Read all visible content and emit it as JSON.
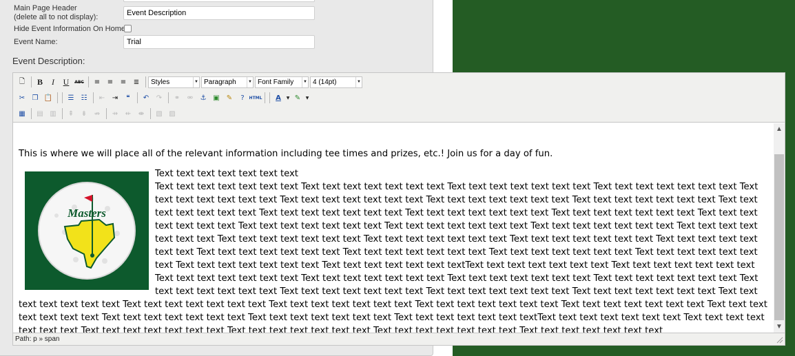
{
  "form": {
    "main_header_label": "Main Page Header",
    "main_header_sublabel": "(delete all to not display):",
    "main_header_value": "Event Description",
    "hide_event_label": "Hide Event Information On Home:",
    "event_name_label": "Event Name:",
    "event_name_value": "Trial",
    "event_description_label": "Event Description:"
  },
  "editor": {
    "toolbar": {
      "styles": "Styles",
      "format": "Paragraph",
      "font_family": "Font Family",
      "font_size": "4 (14pt)",
      "html_label": "HTML"
    },
    "content": {
      "intro": "This is where we will place all of the relevant information including tee times and prizes, etc.! Join us for a day of fun.",
      "first_line": "Text text text text text text text",
      "body": "Text text text text text text text Text text text text text text text Text text text text text text text Text text text text text text text Text text text text text text text Text text text text text text text Text text text text text text text Text text text text text text text Text text text text text text text Text text text text text text text Text text text text text text text Text text text text text text text Text text text text text text text Text text text text text text text Text text text text text text text Text text text text text text text Text text text text text text text Text text text text text text text Text text text text text text text Text text text text text text text Text text text text text text text Text text text text text text text Text text text text text text text Text text text text text text text Text text text text text text text Text text text text text text text Text text text text text text textText text text text text text text Text text text text text text text Text text text text text text text Text text text text text text text Text text text text text text text Text text text text text text text Text text text text text text text Text text text text text text text Text text text text text text text Text text text text text text text Text text text text text text text Text text text text text text text Text text text text text text text Text text text text text text text Text text text text text text text Text text text text text text text Text text text text text text text Text text text text text text text Text text text text text text textText text text text text text text Text text text text text text text Text text text text text text text Text text text text text text text Text text text text text text text Text text text text text text text"
    },
    "logo_text": "Masters",
    "status_path": "Path: p » span"
  },
  "colors": {
    "page_green": "#245c24",
    "logo_green": "#0d5a2d",
    "logo_yellow": "#f2e21a",
    "flag_red": "#d4132a"
  }
}
